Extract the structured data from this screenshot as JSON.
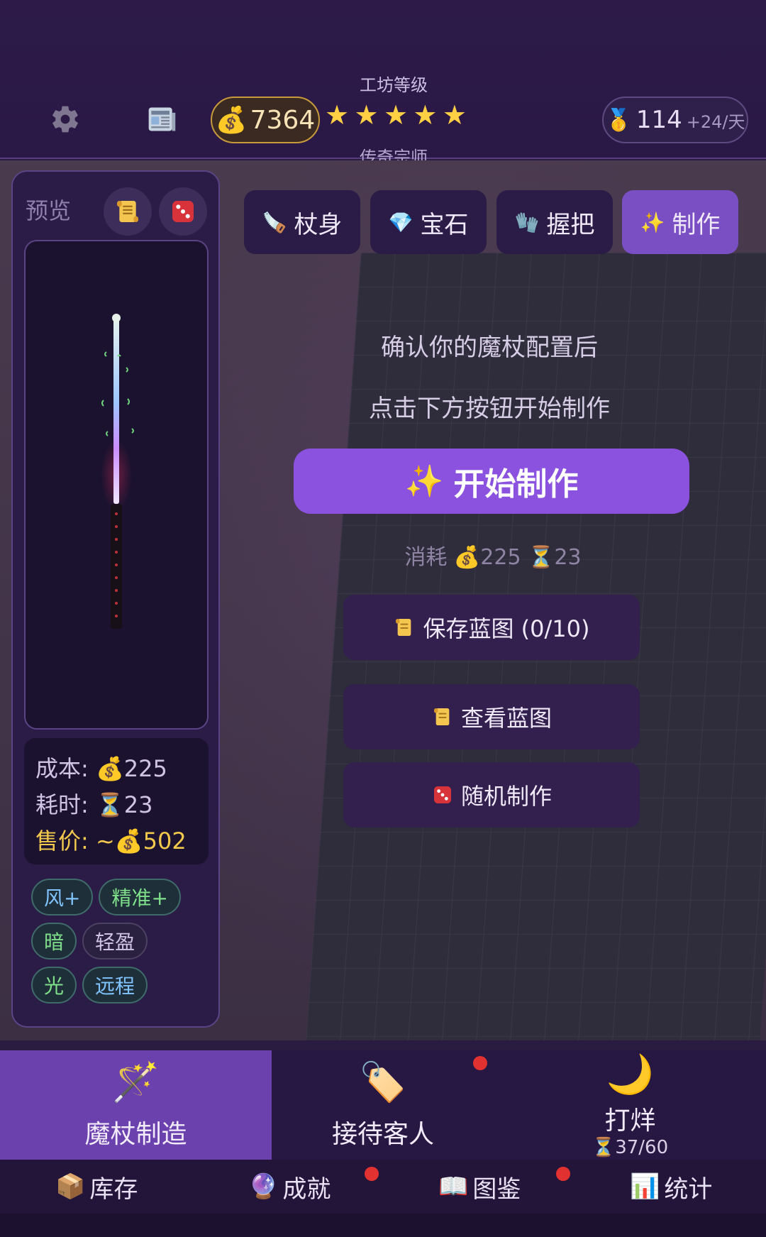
{
  "header": {
    "coins": "7364",
    "workshop_level_label": "工坊等级",
    "stars": [
      "★",
      "★",
      "★",
      "★",
      "★"
    ],
    "workshop_rank": "传奇宗师",
    "reputation": "114",
    "reputation_rate": "+24/天"
  },
  "preview": {
    "label": "预览",
    "cost": "成本: 💰225",
    "time": "耗时: ⏳23",
    "price": "售价: ~💰502",
    "tags": [
      {
        "text": "风+",
        "color": "#7fc4ff"
      },
      {
        "text": "精准+",
        "color": "#7fe08a"
      },
      {
        "text": "暗",
        "color": "#7fe08a"
      },
      {
        "text": "轻盈",
        "color": "#cfc4e3"
      },
      {
        "text": "光",
        "color": "#7fe08a"
      },
      {
        "text": "远程",
        "color": "#7fc4ff"
      }
    ]
  },
  "tabs": [
    {
      "label": "杖身",
      "icon": "🪚"
    },
    {
      "label": "宝石",
      "icon": "💎"
    },
    {
      "label": "握把",
      "icon": "🧤"
    },
    {
      "label": "制作",
      "icon": "✨"
    }
  ],
  "craft": {
    "instruction_1": "确认你的魔杖配置后",
    "instruction_2": "点击下方按钮开始制作",
    "start_label": "开始制作",
    "cost_line": "消耗 💰225  ⏳23",
    "save_label": "保存蓝图 (0/10)",
    "view_label": "查看蓝图",
    "random_label": "随机制作"
  },
  "nav": {
    "craft_label": "魔杖制造",
    "guests_label": "接待客人",
    "idle_label": "打烊",
    "idle_progress": "⏳37/60",
    "inventory_label": "库存",
    "achievements_label": "成就",
    "codex_label": "图鉴",
    "stats_label": "统计"
  },
  "colors": {
    "accent": "#8a52de",
    "active_tab": "#7a4fc4",
    "star": "#ffd043",
    "price": "#f2c94c",
    "notification": "#e23131"
  }
}
